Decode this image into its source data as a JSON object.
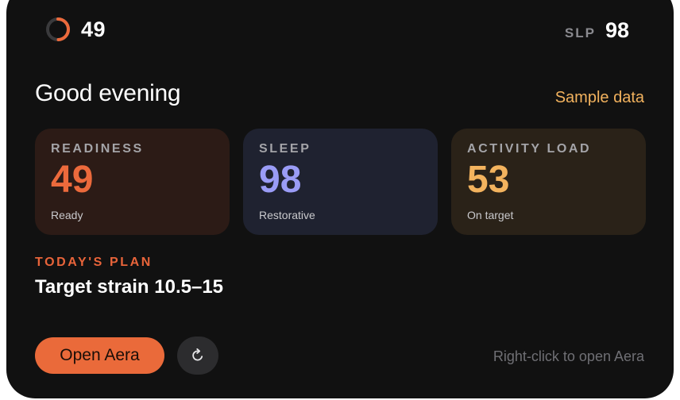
{
  "header": {
    "readiness_score": "49",
    "readiness_ring_fraction": 0.49,
    "slp_label": "SLP",
    "slp_value": "98"
  },
  "greeting": "Good evening",
  "data_tag": "Sample data",
  "cards": [
    {
      "label": "READINESS",
      "value": "49",
      "status": "Ready",
      "color": "#ec6a3c"
    },
    {
      "label": "SLEEP",
      "value": "98",
      "status": "Restorative",
      "color": "#9a9cf6"
    },
    {
      "label": "ACTIVITY LOAD",
      "value": "53",
      "status": "On target",
      "color": "#f3b35e"
    }
  ],
  "plan": {
    "label": "TODAY'S PLAN",
    "text": "Target strain 10.5–15"
  },
  "actions": {
    "open_label": "Open Aera",
    "refresh_icon": "refresh-icon",
    "hint": "Right-click to open Aera"
  },
  "colors": {
    "accent": "#ea6a3a",
    "sample_tag": "#f2b25e"
  }
}
